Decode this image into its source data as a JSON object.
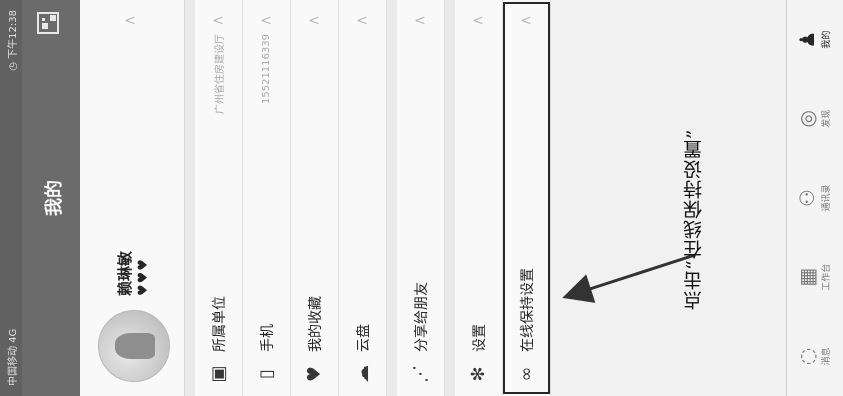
{
  "status_bar": {
    "left": "中国移动 4G",
    "right": "◷ 下午12:38"
  },
  "header": {
    "title": "我的"
  },
  "profile": {
    "name": "赖琳敏",
    "hearts": "♥♥♥"
  },
  "menu": [
    {
      "icon": "building-icon",
      "glyph": "▣",
      "label": "所属单位",
      "value": "广州省住房建设厅"
    },
    {
      "icon": "phone-icon",
      "glyph": "▯",
      "label": "手机",
      "value": "15521116339"
    },
    {
      "icon": "heart-icon",
      "glyph": "♥",
      "label": "我的收藏",
      "value": ""
    },
    {
      "icon": "cloud-icon",
      "glyph": "☁",
      "label": "云盘",
      "value": ""
    },
    {
      "icon": "share-icon",
      "glyph": "⋰",
      "label": "分享给朋友",
      "value": ""
    },
    {
      "icon": "gear-icon",
      "glyph": "✻",
      "label": "设置",
      "value": ""
    },
    {
      "icon": "link-icon",
      "glyph": "∞",
      "label": "在线保持设置",
      "value": ""
    }
  ],
  "bottom_nav": [
    {
      "icon": "message-icon",
      "glyph": "◌",
      "label": "消息"
    },
    {
      "icon": "work-icon",
      "glyph": "▦",
      "label": "工作台"
    },
    {
      "icon": "contacts-icon",
      "glyph": "⚇",
      "label": "通讯录"
    },
    {
      "icon": "discover-icon",
      "glyph": "◎",
      "label": "发现"
    },
    {
      "icon": "me-icon",
      "glyph": "♟",
      "label": "我的"
    }
  ],
  "annotation": {
    "text": "点击“在线保持设置”"
  }
}
